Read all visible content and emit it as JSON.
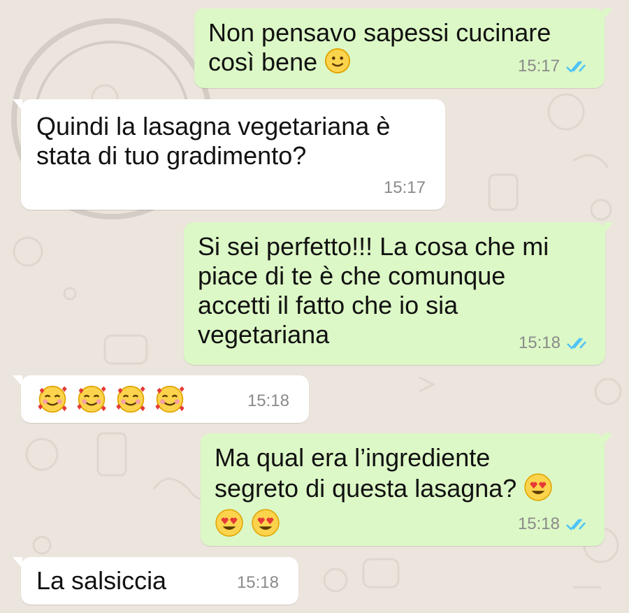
{
  "colors": {
    "background": "#ece5dd",
    "outgoing_bubble": "#dcf8c6",
    "incoming_bubble": "#ffffff",
    "read_ticks": "#4fc3f7",
    "timestamp": "#8a8a8a"
  },
  "messages": [
    {
      "direction": "outgoing",
      "text": "Non pensavo sapessi cucinare\ncosì bene",
      "emoji": [
        "slightly-smiling-face"
      ],
      "time": "15:17",
      "status": "read"
    },
    {
      "direction": "incoming",
      "text": "Quindi la lasagna vegetariana è\nstata di tuo gradimento?",
      "time": "15:17"
    },
    {
      "direction": "outgoing",
      "text": "Si sei perfetto!!! La cosa che mi\npiace di te è che comunque\naccetti il fatto che io sia\nvegetariana",
      "time": "15:18",
      "status": "read"
    },
    {
      "direction": "incoming",
      "text": "",
      "emoji": [
        "smiling-face-with-hearts",
        "smiling-face-with-hearts",
        "smiling-face-with-hearts",
        "smiling-face-with-hearts"
      ],
      "time": "15:18"
    },
    {
      "direction": "outgoing",
      "text": "Ma qual era l’ingrediente\nsegreto di questa lasagna?",
      "emoji": [
        "heart-eyes-face",
        "heart-eyes-face",
        "heart-eyes-face"
      ],
      "time": "15:18",
      "status": "read"
    },
    {
      "direction": "incoming",
      "text": "La salsiccia",
      "time": "15:18"
    }
  ]
}
